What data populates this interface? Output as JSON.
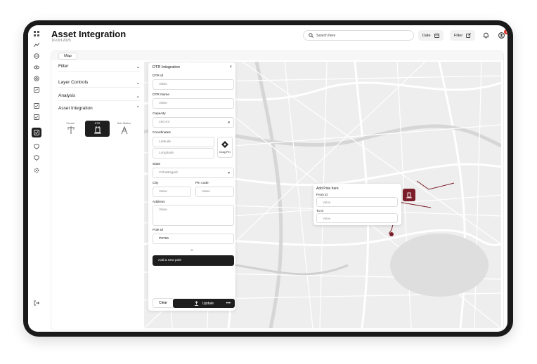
{
  "header": {
    "title": "Asset Integration",
    "date": "10-Oct-2025",
    "search_placeholder": "Search here",
    "date_btn": "Date",
    "filter_btn": "Filter",
    "notifications": "1"
  },
  "tabs": [
    "Map"
  ],
  "sidebar": {
    "sections": [
      "Filter",
      "Layer Controls",
      "Analysis",
      "Asset Integration"
    ],
    "assets": [
      "Feeder",
      "DTR",
      "Sub-Station"
    ]
  },
  "form": {
    "title": "DTR Integration",
    "dtr_id_label": "DTR Id",
    "dtr_id_value": "Value",
    "dtr_name_label": "DTR Name",
    "dtr_name_value": "Value",
    "capacity_label": "Capacity",
    "capacity_value": "100 KV",
    "coordinates_label": "Coordinates",
    "latitude": "Latitude",
    "longitude": "Longitude",
    "drag_pin": "Drag Pin",
    "state_label": "State",
    "state_value": "Chhattisgarh",
    "city_label": "City",
    "city_value": "Value",
    "pincode_label": "Pin code",
    "pincode_value": "Value",
    "address_label": "Address",
    "address_value": "Value",
    "pole_id_label": "Pole Id",
    "pole_id_value": "P8756",
    "or": "or",
    "add_pole": "Add a new pole",
    "clear": "Clear",
    "update": "Update"
  },
  "popup": {
    "title": "Add Pole here",
    "from_label": "From Id",
    "from_value": "Value",
    "to_label": "To Id",
    "to_value": "Value"
  },
  "colors": {
    "accent": "#7b1e2a",
    "dark": "#1e1e1e"
  }
}
